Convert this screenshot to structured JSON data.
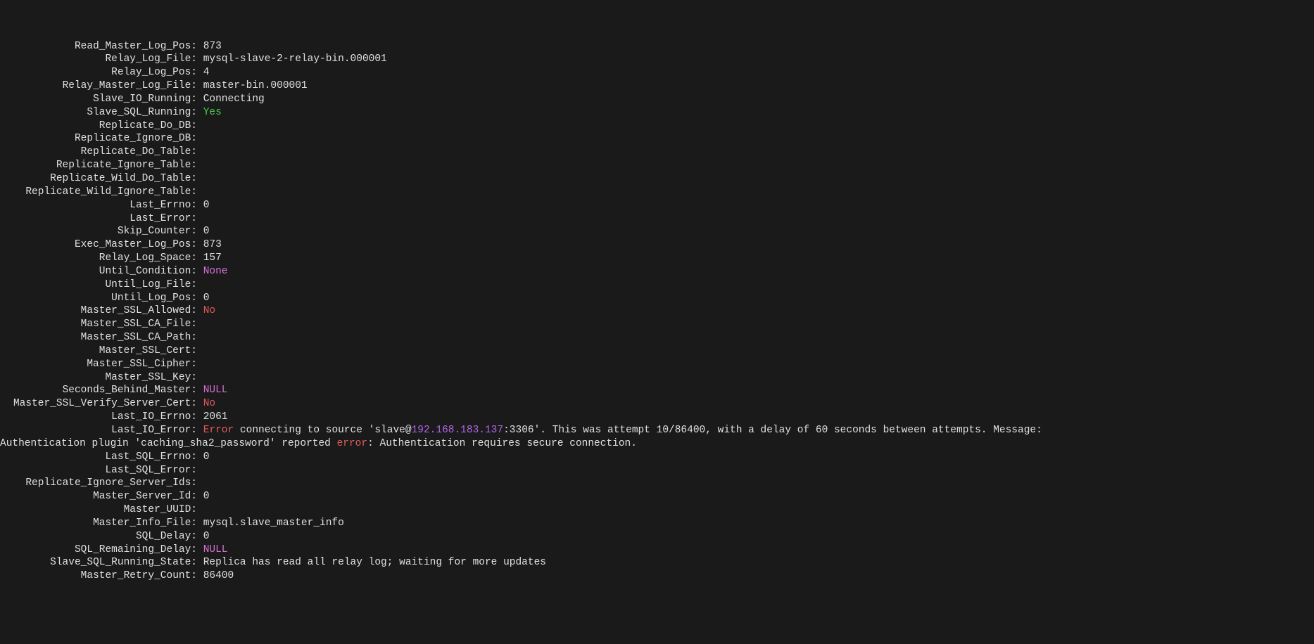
{
  "rows": [
    {
      "label": "Read_Master_Log_Pos",
      "value": "873"
    },
    {
      "label": "Relay_Log_File",
      "value": "mysql-slave-2-relay-bin.000001"
    },
    {
      "label": "Relay_Log_Pos",
      "value": "4"
    },
    {
      "label": "Relay_Master_Log_File",
      "value": "master-bin.000001"
    },
    {
      "label": "Slave_IO_Running",
      "value": "Connecting"
    },
    {
      "label": "Slave_SQL_Running",
      "value": "Yes",
      "color": "green"
    },
    {
      "label": "Replicate_Do_DB",
      "value": ""
    },
    {
      "label": "Replicate_Ignore_DB",
      "value": ""
    },
    {
      "label": "Replicate_Do_Table",
      "value": ""
    },
    {
      "label": "Replicate_Ignore_Table",
      "value": ""
    },
    {
      "label": "Replicate_Wild_Do_Table",
      "value": ""
    },
    {
      "label": "Replicate_Wild_Ignore_Table",
      "value": ""
    },
    {
      "label": "Last_Errno",
      "value": "0"
    },
    {
      "label": "Last_Error",
      "value": ""
    },
    {
      "label": "Skip_Counter",
      "value": "0"
    },
    {
      "label": "Exec_Master_Log_Pos",
      "value": "873"
    },
    {
      "label": "Relay_Log_Space",
      "value": "157"
    },
    {
      "label": "Until_Condition",
      "value": "None",
      "color": "magenta"
    },
    {
      "label": "Until_Log_File",
      "value": ""
    },
    {
      "label": "Until_Log_Pos",
      "value": "0"
    },
    {
      "label": "Master_SSL_Allowed",
      "value": "No",
      "color": "red"
    },
    {
      "label": "Master_SSL_CA_File",
      "value": ""
    },
    {
      "label": "Master_SSL_CA_Path",
      "value": ""
    },
    {
      "label": "Master_SSL_Cert",
      "value": ""
    },
    {
      "label": "Master_SSL_Cipher",
      "value": ""
    },
    {
      "label": "Master_SSL_Key",
      "value": ""
    },
    {
      "label": "Seconds_Behind_Master",
      "value": "NULL",
      "color": "magenta"
    },
    {
      "label": "Master_SSL_Verify_Server_Cert",
      "value": "No",
      "color": "red"
    },
    {
      "label": "Last_IO_Errno",
      "value": "2061"
    }
  ],
  "last_io_error": {
    "label": "Last_IO_Error",
    "segments": [
      {
        "text": "Error",
        "color": "red"
      },
      {
        "text": " connecting to source 'slave@"
      },
      {
        "text": "192.168.183.137",
        "color": "purple"
      },
      {
        "text": ":3306'. This was attempt 10/86400, with a delay of 60 seconds between attempts. Message:"
      }
    ],
    "wrap_segments": [
      {
        "text": "Authentication plugin 'caching_sha2_password' reported "
      },
      {
        "text": "error",
        "color": "red"
      },
      {
        "text": ": Authentication requires secure connection."
      }
    ]
  },
  "rows_after": [
    {
      "label": "Last_SQL_Errno",
      "value": "0"
    },
    {
      "label": "Last_SQL_Error",
      "value": ""
    },
    {
      "label": "Replicate_Ignore_Server_Ids",
      "value": ""
    },
    {
      "label": "Master_Server_Id",
      "value": "0"
    },
    {
      "label": "Master_UUID",
      "value": ""
    },
    {
      "label": "Master_Info_File",
      "value": "mysql.slave_master_info"
    },
    {
      "label": "SQL_Delay",
      "value": "0"
    },
    {
      "label": "SQL_Remaining_Delay",
      "value": "NULL",
      "color": "magenta"
    },
    {
      "label": "Slave_SQL_Running_State",
      "value": "Replica has read all relay log; waiting for more updates"
    },
    {
      "label": "Master_Retry_Count",
      "value": "86400"
    }
  ]
}
